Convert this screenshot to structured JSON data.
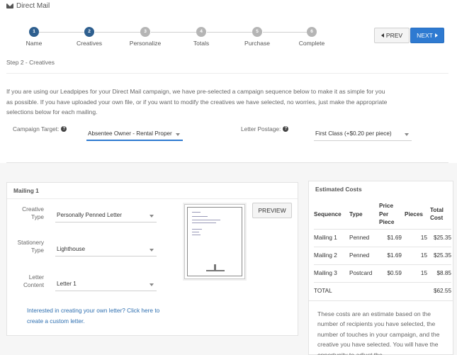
{
  "header": {
    "title": "Direct Mail",
    "icon": "envelope-icon"
  },
  "stepper": {
    "steps": [
      {
        "number": "1",
        "label": "Name",
        "state": "active"
      },
      {
        "number": "2",
        "label": "Creatives",
        "state": "active"
      },
      {
        "number": "3",
        "label": "Personalize",
        "state": "inactive"
      },
      {
        "number": "4",
        "label": "Totals",
        "state": "inactive"
      },
      {
        "number": "5",
        "label": "Purchase",
        "state": "inactive"
      },
      {
        "number": "6",
        "label": "Complete",
        "state": "inactive"
      }
    ]
  },
  "nav": {
    "prev_label": "PREV",
    "next_label": "NEXT"
  },
  "step_heading": "Step 2 - Creatives",
  "intro_text": "If you are using our Leadpipes for your Direct Mail campaign, we have pre-selected a campaign sequence below to make it as simple for you as possible. If you have uploaded your own file, or if you want to modify the creatives we have selected, no worries, just make the appropriate selections below for each mailing.",
  "campaign": {
    "target_label": "Campaign Target:",
    "target_value": "Absentee Owner - Rental Proper",
    "postage_label": "Letter Postage:",
    "postage_value": "First Class (+$0.20 per piece)"
  },
  "mailing": {
    "title": "Mailing 1",
    "creative_type_label": "Creative Type",
    "creative_type_value": "Personally Penned Letter",
    "stationery_type_label": "Stationery Type",
    "stationery_type_value": "Lighthouse",
    "letter_content_label": "Letter Content",
    "letter_content_value": "Letter 1",
    "preview_label": "PREVIEW",
    "custom_link": "Interested in creating your own letter? Click here to create a custom letter."
  },
  "estimated_costs": {
    "title": "Estimated Costs",
    "headers": [
      "Sequence",
      "Type",
      "Price Per Piece",
      "Pieces",
      "Total Cost"
    ],
    "rows": [
      {
        "sequence": "Mailing 1",
        "type": "Penned",
        "price": "$1.69",
        "pieces": "15",
        "total": "$25.35"
      },
      {
        "sequence": "Mailing 2",
        "type": "Penned",
        "price": "$1.69",
        "pieces": "15",
        "total": "$25.35"
      },
      {
        "sequence": "Mailing 3",
        "type": "Postcard",
        "price": "$0.59",
        "pieces": "15",
        "total": "$8.85"
      }
    ],
    "total_label": "TOTAL",
    "total_value": "$62.55",
    "disclaimer": "These costs are an estimate based on the number of recipients you have selected, the number of touches in your campaign, and the creative you have selected. You will have the opportunity to adjust the"
  }
}
